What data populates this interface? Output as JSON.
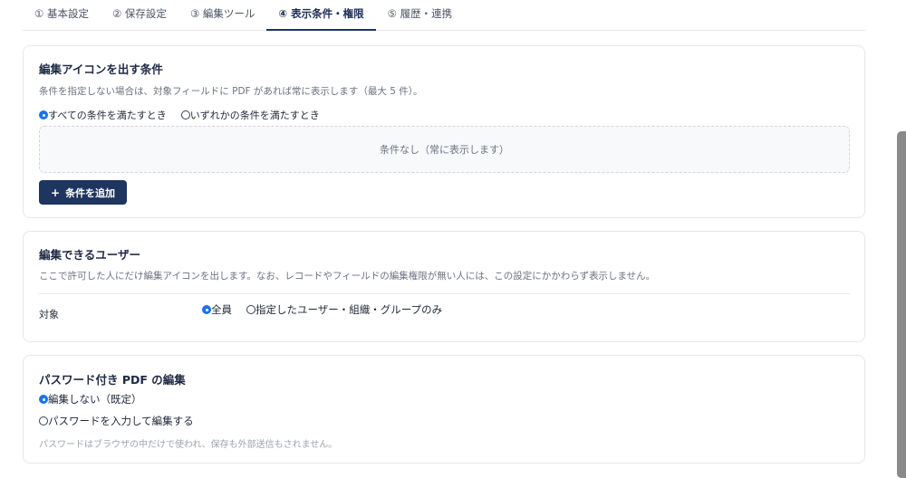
{
  "tabs": [
    {
      "label": "① 基本設定",
      "active": false
    },
    {
      "label": "② 保存設定",
      "active": false
    },
    {
      "label": "③ 編集ツール",
      "active": false
    },
    {
      "label": "④ 表示条件・権限",
      "active": true
    },
    {
      "label": "⑤ 履歴・連携",
      "active": false
    }
  ],
  "conditions": {
    "title": "編集アイコンを出す条件",
    "description": "条件を指定しない場合は、対象フィールドに PDF があれば常に表示します（最大 5 件）。",
    "match_all_label": "すべての条件を満たすとき",
    "match_any_label": "いずれかの条件を満たすとき",
    "selected": "all",
    "empty_text": "条件なし（常に表示します）",
    "add_button_icon": "+",
    "add_button_label": "条件を追加"
  },
  "users": {
    "title": "編集できるユーザー",
    "description": "ここで許可した人にだけ編集アイコンを出します。なお、レコードやフィールドの編集権限が無い人には、この設定にかかわらず表示しません。",
    "target_label": "対象",
    "option_all": "全員",
    "option_specified": "指定したユーザー・組織・グループのみ",
    "selected": "all"
  },
  "password_pdf": {
    "title": "パスワード付き PDF の編集",
    "option_no_edit": "編集しない（既定）",
    "option_edit": "パスワードを入力して編集する",
    "selected": "no_edit",
    "hint": "パスワードはブラウザの中だけで使われ、保存も外部送信もされません。"
  },
  "colors": {
    "accent": "#1e3560",
    "radio_checked": "#1a73e8"
  }
}
